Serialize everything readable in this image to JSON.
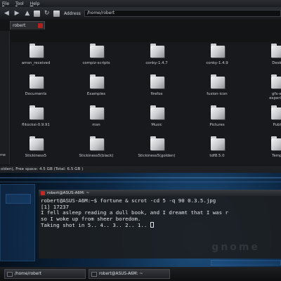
{
  "menubar": {
    "items": [
      {
        "label": "File",
        "mnemonic": "F",
        "rest": "ile"
      },
      {
        "label": "Tool",
        "mnemonic": "T",
        "rest": "ool"
      },
      {
        "label": "Help",
        "mnemonic": "H",
        "rest": "elp"
      }
    ]
  },
  "toolbar": {
    "icons": [
      "back-icon",
      "forward-icon",
      "up-icon",
      "home-icon",
      "refresh-icon",
      "folder-icon"
    ],
    "address_label": "Address",
    "address_value": "/home/robert"
  },
  "tabs": [
    {
      "label": "robert"
    }
  ],
  "sidepane": {
    "label": "me"
  },
  "files": [
    "amsn_received",
    "compiz-scripts",
    "conky-1.4.7",
    "conky-1.4.9",
    "Desktop",
    "Documents",
    "Examples",
    "firefox",
    "fusion-icon",
    "gfx-emerald-experimental",
    "flitocksi-0.9.91",
    "msn",
    "Music",
    "Pictures",
    "Public",
    "Stickiness5",
    "Stickiness5(black)",
    "Stickiness5(golden)",
    "tdf8.5.0",
    "Templates"
  ],
  "files_display": [
    "amsn_received",
    "compiz-scripts",
    "conky-1.4.7",
    "conky-1.4.9",
    "Deskt",
    "Documents",
    "Examples",
    "firefox",
    "fusion-icon",
    "gfx-er\nexperien",
    "flitocksi-0.9.91",
    "msn",
    "Music",
    "Pictures",
    "Publi",
    "Stickiness5",
    "Stickiness5(black)",
    "Stickiness5(golden)",
    "tdf8.5.0",
    "Templ"
  ],
  "statusbar": {
    "text": "olden), Free space: 4.5 GB (Total: 6.5 GB )"
  },
  "terminal": {
    "title": "robert@ASUS-A6M: ~",
    "lines": [
      "robert@ASUS-A6M:~$ fortune & scrot -cd 5 -q 90 0.3.5.jpg",
      "[1] 17237",
      "I fell asleep reading a dull book, and I dreamt that I was r",
      "so I woke up from sheer boredom.",
      "Taking shot in 5.. 4.. 3.. 2.. 1.. "
    ],
    "watermark": "gnome"
  },
  "panel": {
    "tasks": [
      {
        "label": "/home/robert"
      },
      {
        "label": "robert@ASUS-A6M: ~"
      }
    ]
  },
  "colors": {
    "close": "#c42a24",
    "terminal_bg": "#1c1e21",
    "wallpaper_accent": "#1d4f7d"
  }
}
